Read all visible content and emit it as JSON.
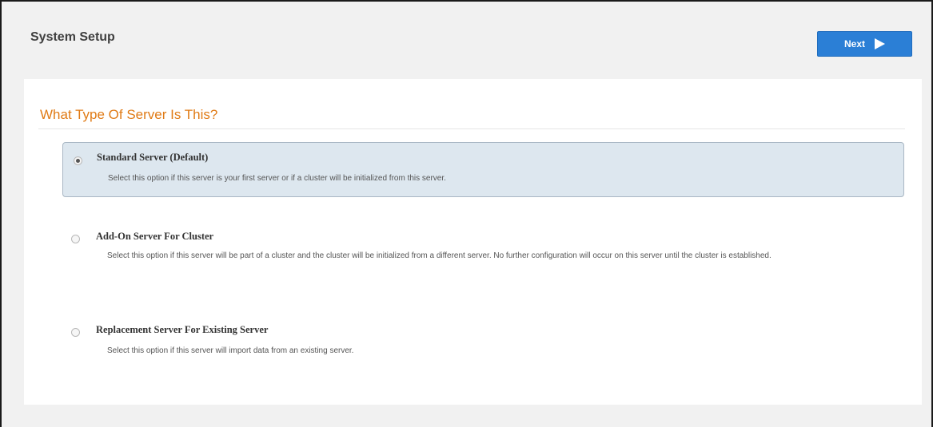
{
  "header": {
    "title": "System Setup",
    "next_label": "Next",
    "next_icon": "play-icon"
  },
  "section": {
    "title": "What Type Of Server Is This?"
  },
  "options": [
    {
      "title": "Standard Server (Default)",
      "description": "Select this option if this server is your first server or if a cluster will be initialized from this server.",
      "selected": true
    },
    {
      "title": "Add-On Server For Cluster",
      "description": "Select this option if this server will be part of a cluster and the cluster will be initialized from a different server. No further configuration will occur on this server until the cluster is established.",
      "selected": false
    },
    {
      "title": "Replacement Server For Existing Server",
      "description": "Select this option if this server will import data from an existing server.",
      "selected": false
    }
  ],
  "colors": {
    "accent": "#2b7fd6",
    "section_title": "#e07b16",
    "selected_bg": "#dde7ef"
  }
}
